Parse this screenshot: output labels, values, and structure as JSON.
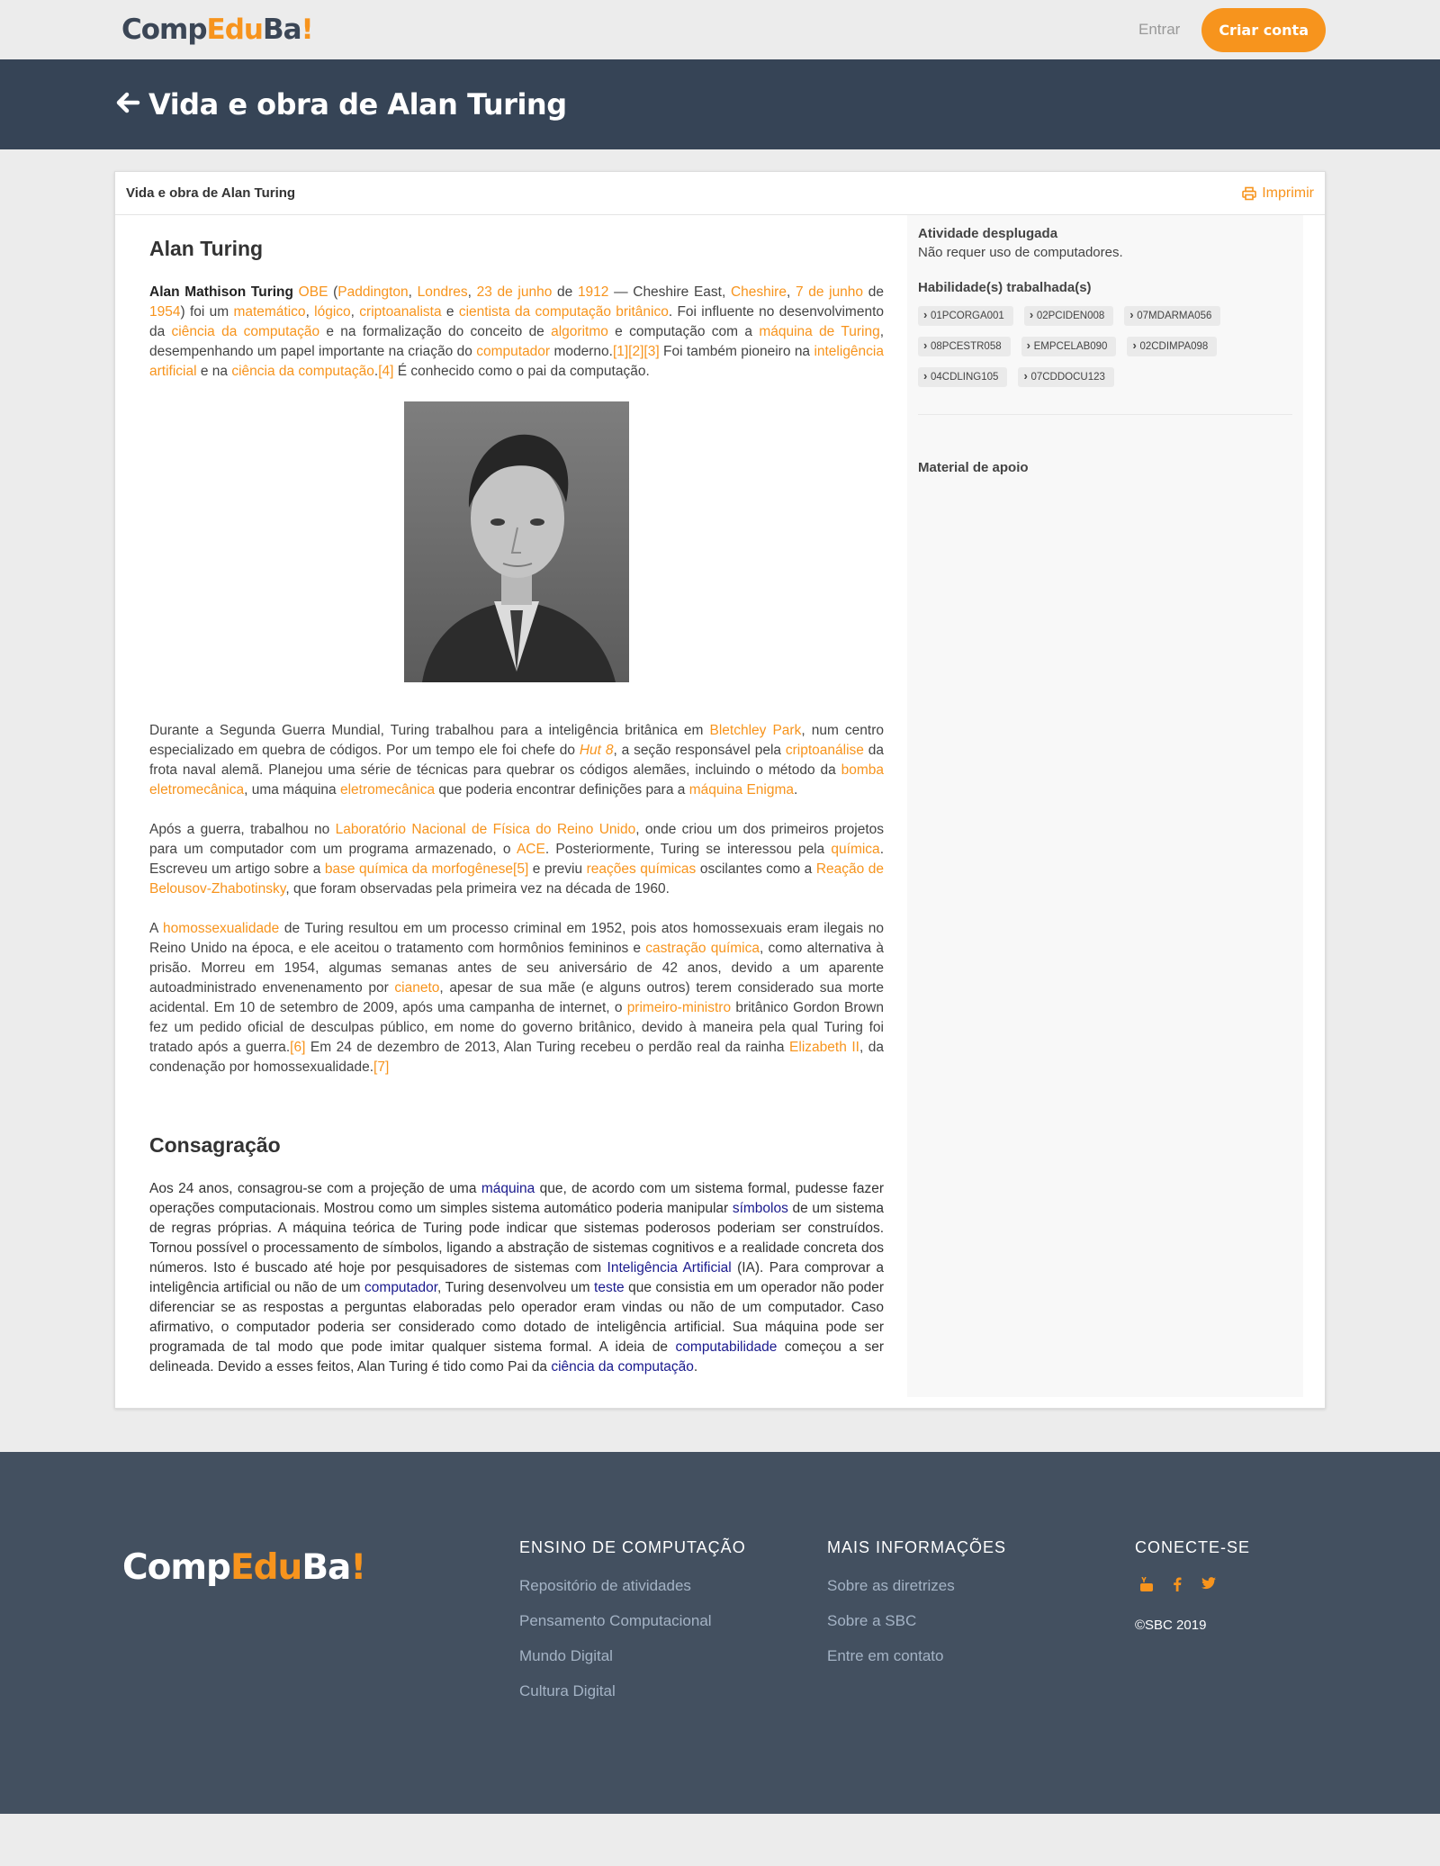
{
  "nav": {
    "logo": {
      "part1": "Comp",
      "part2": "Edu",
      "part3": "Ba",
      "part4": "!"
    },
    "login": "Entrar",
    "signup": "Criar conta"
  },
  "header": {
    "title": "Vida e obra de Alan Turing"
  },
  "card": {
    "title": "Vida e obra de Alan Turing",
    "print": "Imprimir"
  },
  "article": {
    "heading1": "Alan Turing",
    "heading2": "Consagração",
    "p1": [
      {
        "t": "Alan Mathison Turing",
        "s": "b"
      },
      {
        "t": " "
      },
      {
        "t": "OBE",
        "s": "o"
      },
      {
        "t": " ("
      },
      {
        "t": "Paddington",
        "s": "o"
      },
      {
        "t": ", "
      },
      {
        "t": "Londres",
        "s": "o"
      },
      {
        "t": ", "
      },
      {
        "t": "23 de junho",
        "s": "o"
      },
      {
        "t": " de "
      },
      {
        "t": "1912",
        "s": "o"
      },
      {
        "t": " — Cheshire East, "
      },
      {
        "t": "Cheshire",
        "s": "o"
      },
      {
        "t": ", "
      },
      {
        "t": "7 de junho",
        "s": "o"
      },
      {
        "t": " de "
      },
      {
        "t": "1954",
        "s": "o"
      },
      {
        "t": ") foi um "
      },
      {
        "t": "matemático",
        "s": "o"
      },
      {
        "t": ", "
      },
      {
        "t": "lógico",
        "s": "o"
      },
      {
        "t": ", "
      },
      {
        "t": "criptoanalista",
        "s": "o"
      },
      {
        "t": " e "
      },
      {
        "t": "cientista da computação britânico",
        "s": "o"
      },
      {
        "t": ". Foi influente no desenvolvimento da "
      },
      {
        "t": "ciência da computação",
        "s": "o"
      },
      {
        "t": " e na formalização do conceito de "
      },
      {
        "t": "algoritmo",
        "s": "o"
      },
      {
        "t": " e computação com a "
      },
      {
        "t": "máquina de Turing",
        "s": "o"
      },
      {
        "t": ", desempenhando um papel importante na criação do "
      },
      {
        "t": "computador",
        "s": "o"
      },
      {
        "t": " moderno."
      },
      {
        "t": "[1][2][3]",
        "s": "o"
      },
      {
        "t": " Foi também pioneiro na "
      },
      {
        "t": "inteligência artificial",
        "s": "o"
      },
      {
        "t": " e na "
      },
      {
        "t": "ciência da computação",
        "s": "o"
      },
      {
        "t": "."
      },
      {
        "t": "[4]",
        "s": "o"
      },
      {
        "t": " É conhecido como o pai da computação."
      }
    ],
    "p2": [
      {
        "t": "Durante a Segunda Guerra Mundial, Turing trabalhou para a inteligência britânica em "
      },
      {
        "t": "Bletchley Park",
        "s": "o"
      },
      {
        "t": ", num centro especializado em quebra de códigos. Por um tempo ele foi chefe do "
      },
      {
        "t": "Hut 8",
        "s": "oi"
      },
      {
        "t": ", a seção responsável pela "
      },
      {
        "t": "criptoanálise",
        "s": "o"
      },
      {
        "t": " da frota naval alemã. Planejou uma série de técnicas para quebrar os códigos alemães, incluindo o método da "
      },
      {
        "t": "bomba eletromecânica",
        "s": "o"
      },
      {
        "t": ", uma máquina "
      },
      {
        "t": "eletromecânica",
        "s": "o"
      },
      {
        "t": " que poderia encontrar definições para a "
      },
      {
        "t": "máquina Enigma",
        "s": "o"
      },
      {
        "t": "."
      }
    ],
    "p3": [
      {
        "t": "Após a guerra, trabalhou no "
      },
      {
        "t": "Laboratório Nacional de Física do Reino Unido",
        "s": "o"
      },
      {
        "t": ", onde criou um dos primeiros projetos para um computador com um programa armazenado, o "
      },
      {
        "t": "ACE",
        "s": "o"
      },
      {
        "t": ". Posteriormente, Turing se interessou pela "
      },
      {
        "t": "química",
        "s": "o"
      },
      {
        "t": ". Escreveu um artigo sobre a "
      },
      {
        "t": "base química da morfogênese",
        "s": "o"
      },
      {
        "t": "[5]",
        "s": "o"
      },
      {
        "t": " e previu "
      },
      {
        "t": "reações químicas",
        "s": "o"
      },
      {
        "t": " oscilantes como a "
      },
      {
        "t": "Reação de Belousov-Zhabotinsky",
        "s": "o"
      },
      {
        "t": ", que foram observadas pela primeira vez na década de 1960."
      }
    ],
    "p4": [
      {
        "t": "A "
      },
      {
        "t": "homossexualidade",
        "s": "o"
      },
      {
        "t": " de Turing resultou em um processo criminal em 1952, pois atos homossexuais eram ilegais no Reino Unido na época, e ele aceitou o tratamento com hormônios femininos e "
      },
      {
        "t": "castração química",
        "s": "o"
      },
      {
        "t": ", como alternativa à prisão. Morreu em 1954, algumas semanas antes de seu aniversário de 42 anos, devido a um aparente autoadministrado envenenamento por "
      },
      {
        "t": "cianeto",
        "s": "o"
      },
      {
        "t": ", apesar de sua mãe (e alguns outros) terem considerado sua morte acidental. Em 10 de setembro de 2009, após uma campanha de internet, o "
      },
      {
        "t": "primeiro-ministro",
        "s": "o"
      },
      {
        "t": " britânico Gordon Brown fez um pedido oficial de desculpas público, em nome do governo britânico, devido à maneira pela qual Turing foi tratado após a guerra."
      },
      {
        "t": "[6]",
        "s": "o"
      },
      {
        "t": " Em 24 de dezembro de 2013, Alan Turing recebeu o perdão real da rainha "
      },
      {
        "t": "Elizabeth II",
        "s": "o"
      },
      {
        "t": ", da condenação por homossexualidade."
      },
      {
        "t": "[7]",
        "s": "o"
      }
    ],
    "p5": [
      {
        "t": "Aos 24 anos, consagrou-se com a projeção de uma "
      },
      {
        "t": "máquina",
        "s": "n"
      },
      {
        "t": " que, de acordo com um sistema formal, pudesse fazer operações computacionais. Mostrou como um simples sistema automático poderia manipular "
      },
      {
        "t": "símbolos",
        "s": "n"
      },
      {
        "t": " de um sistema de regras próprias. A máquina teórica de Turing pode indicar que sistemas poderosos poderiam ser construídos. Tornou possível o processamento de símbolos, ligando a abstração de sistemas cognitivos e a realidade concreta dos números. Isto é buscado até hoje por pesquisadores de sistemas com "
      },
      {
        "t": "Inteligência Artificial",
        "s": "n"
      },
      {
        "t": " (IA). Para comprovar a inteligência artificial ou não de um "
      },
      {
        "t": "computador",
        "s": "n"
      },
      {
        "t": ", Turing desenvolveu um "
      },
      {
        "t": "teste",
        "s": "n"
      },
      {
        "t": " que consistia em um operador não poder diferenciar se as respostas a perguntas elaboradas pelo operador eram vindas ou não de um computador. Caso afirmativo, o computador poderia ser considerado como dotado de inteligência artificial. Sua máquina pode ser programada de tal modo que pode imitar qualquer sistema formal. A ideia de "
      },
      {
        "t": "computabilidade",
        "s": "n"
      },
      {
        "t": " começou a ser delineada. Devido a esses feitos, Alan Turing é tido como Pai da "
      },
      {
        "t": "ciência da computação",
        "s": "n"
      },
      {
        "t": "."
      }
    ]
  },
  "sidebar": {
    "activity_label": "Atividade desplugada",
    "activity_text": "Não requer uso de computadores.",
    "skills_label": "Habilidade(s) trabalhada(s)",
    "skills": [
      "01PCORGA001",
      "02PCIDEN008",
      "07MDARMA056",
      "08PCESTR058",
      "EMPCELAB090",
      "02CDIMPA098",
      "04CDLING105",
      "07CDDOCU123"
    ],
    "material_label": "Material de apoio"
  },
  "footer": {
    "col1_title": "ENSINO DE COMPUTAÇÃO",
    "col1_links": [
      "Repositório de atividades",
      "Pensamento Computacional",
      "Mundo Digital",
      "Cultura Digital"
    ],
    "col2_title": "MAIS INFORMAÇÕES",
    "col2_links": [
      "Sobre as diretrizes",
      "Sobre a SBC",
      "Entre em contato"
    ],
    "col3_title": "CONECTE-SE",
    "social": [
      "youtube-icon",
      "facebook-icon",
      "twitter-icon"
    ],
    "copyright": "©SBC 2019"
  },
  "colors": {
    "accent": "#f7941d",
    "header_bg": "#364456",
    "footer_bg": "#435060",
    "link_blue": "#1a1a8c"
  }
}
